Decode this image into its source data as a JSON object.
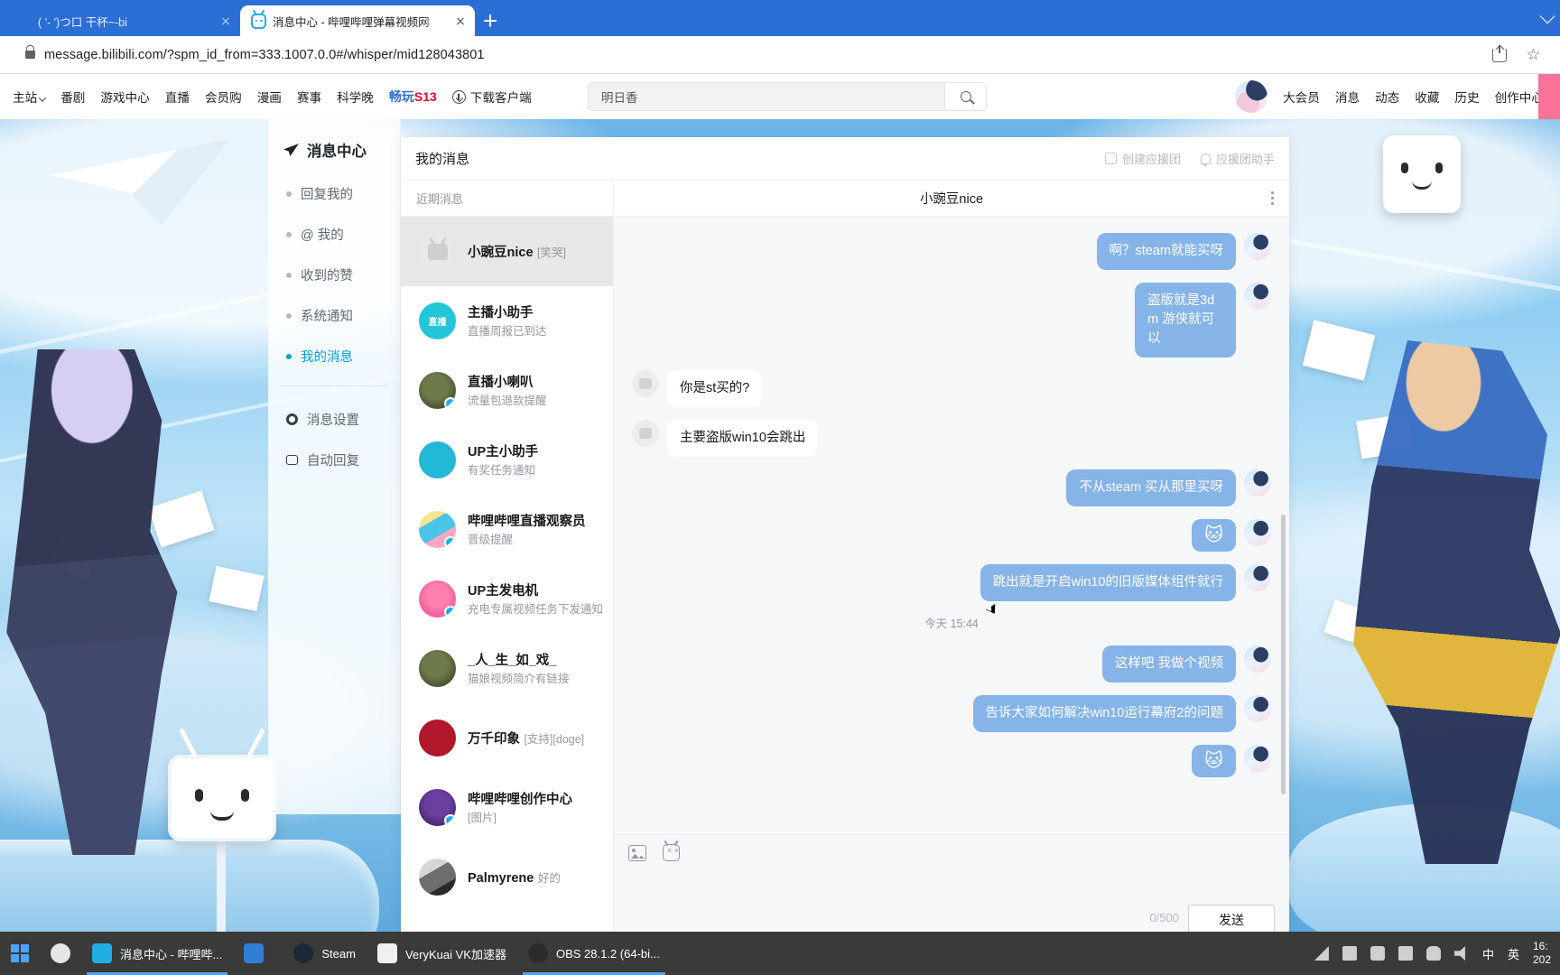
{
  "browser": {
    "tabs": [
      {
        "title": "( '- ')つ口 干杯~-bi",
        "active": false,
        "favicon": "none-icon"
      },
      {
        "title": "消息中心 - 哔哩哔哩弹幕视频网",
        "active": true,
        "favicon": "bilibili-icon"
      }
    ],
    "new_tab_label": "+",
    "url": "message.bilibili.com/?spm_id_from=333.1007.0.0#/whisper/mid128043801",
    "lock_icon": "lock-icon",
    "share_icon": "share-icon",
    "bookmark_icon": "star-icon",
    "minimize_icon": "chevron-down-icon"
  },
  "site_header": {
    "nav_left": [
      "主站",
      "番剧",
      "游戏中心",
      "直播",
      "会员购",
      "漫画",
      "赛事",
      "科学晚"
    ],
    "brand_promo": {
      "blue": "畅玩",
      "red": "S13"
    },
    "download_label": "下载客户端",
    "search": {
      "value": "明日香",
      "placeholder": "明日香",
      "icon": "search-icon"
    },
    "nav_right": [
      "大会员",
      "消息",
      "动态",
      "收藏",
      "历史",
      "创作中心"
    ]
  },
  "message_nav": {
    "title": "消息中心",
    "title_icon": "paper-plane-icon",
    "items": [
      {
        "label": "回复我的",
        "active": false
      },
      {
        "label": "@ 我的",
        "active": false
      },
      {
        "label": "收到的赞",
        "active": false
      },
      {
        "label": "系统通知",
        "active": false
      },
      {
        "label": "我的消息",
        "active": true
      }
    ],
    "footer_items": [
      {
        "label": "消息设置",
        "icon": "gear-icon"
      },
      {
        "label": "自动回复",
        "icon": "reply-icon"
      }
    ]
  },
  "panel": {
    "title": "我的消息",
    "actions": [
      {
        "label": "创建应援团",
        "icon": "group-square-icon"
      },
      {
        "label": "应援团助手",
        "icon": "bell-icon"
      }
    ]
  },
  "conversation_list": {
    "header": "近期消息",
    "items": [
      {
        "name": "小豌豆nice",
        "preview": "[笑哭]",
        "avatar": "av-grey",
        "selected": true,
        "badge": false
      },
      {
        "name": "主播小助手",
        "preview": "直播周报已到达",
        "avatar": "av-cyan",
        "selected": false,
        "badge": false
      },
      {
        "name": "直播小喇叭",
        "preview": "流量包退款提醒",
        "avatar": "av-dark",
        "selected": false,
        "badge": true
      },
      {
        "name": "UP主小助手",
        "preview": "有奖任务通知",
        "avatar": "av-blue",
        "selected": false,
        "badge": false
      },
      {
        "name": "哔哩哔哩直播观察员",
        "preview": "晋级提醒",
        "avatar": "av-mix",
        "selected": false,
        "badge": true
      },
      {
        "name": "UP主发电机",
        "preview": "充电专属视频任务下发通知",
        "avatar": "av-pink",
        "selected": false,
        "badge": true
      },
      {
        "name": "_人_生_如_戏_",
        "preview": "猫娘视频简介有链接",
        "avatar": "av-photo",
        "selected": false,
        "badge": false
      },
      {
        "name": "万千印象",
        "preview": "[支持][doge]",
        "avatar": "av-red",
        "selected": false,
        "badge": false
      },
      {
        "name": "哔哩哔哩创作中心",
        "preview": "[图片]",
        "avatar": "av-purple",
        "selected": false,
        "badge": true
      },
      {
        "name": "Palmyrene",
        "preview": "好的",
        "avatar": "av-photo",
        "selected": false,
        "badge": false
      }
    ]
  },
  "chat": {
    "title": "小豌豆nice",
    "more_icon": "more-vertical-icon",
    "messages": [
      {
        "side": "out",
        "text": "啊？steam就能买呀",
        "type": "text"
      },
      {
        "side": "out",
        "text": "盗版就是3dm 游侠就可以",
        "type": "text"
      },
      {
        "side": "in",
        "text": "你是st买的?",
        "type": "text"
      },
      {
        "side": "in",
        "text": "主要盗版win10会跳出",
        "type": "text"
      },
      {
        "side": "out",
        "text": "不从steam 买从那里买呀",
        "type": "text"
      },
      {
        "side": "out",
        "text": "🐱",
        "type": "emoji"
      },
      {
        "side": "out",
        "text": "跳出就是开启win10的旧版媒体组件就行",
        "type": "text"
      },
      {
        "side": "divider",
        "text": "今天 15:44",
        "type": "timestamp"
      },
      {
        "side": "out",
        "text": "这样吧 我做个视频",
        "type": "text"
      },
      {
        "side": "out",
        "text": "告诉大家如何解决win10运行幕府2的问题",
        "type": "text"
      },
      {
        "side": "out",
        "text": "🐱",
        "type": "emoji"
      }
    ],
    "composer": {
      "image_icon": "image-icon",
      "emoji_icon": "emoji-icon",
      "placeholder": "",
      "value": "",
      "counter": "0/500",
      "send_label": "发送"
    }
  },
  "taskbar": {
    "start_icon": "windows-start-icon",
    "search_icon": "search-icon",
    "items": [
      {
        "label": "消息中心 - 哔哩哔...",
        "icon": "bilibili-icon",
        "active": true
      },
      {
        "label": "",
        "icon": "tv-blue-icon",
        "active": false
      },
      {
        "label": "Steam",
        "icon": "steam-icon",
        "active": false
      },
      {
        "label": "VeryKuai VK加速器",
        "icon": "rocket-icon",
        "active": false
      },
      {
        "label": "OBS 28.1.2 (64-bi...",
        "icon": "obs-icon",
        "active": true
      }
    ],
    "tray": [
      "wifi-icon",
      "folder-icon",
      "shield-icon",
      "monitor-icon",
      "mic-icon",
      "speaker-icon",
      "ime-cn-icon",
      "ime-en-icon"
    ],
    "clock": {
      "time": "16:",
      "date": "202"
    }
  },
  "colors": {
    "bili_blue": "#00a1d6",
    "bubble_out": "#86b4e8",
    "bubble_in": "#ffffff",
    "chrome_blue": "#2b6fd6",
    "pink_accent": "#fb7299",
    "selected_row": "#e7e7e7"
  }
}
